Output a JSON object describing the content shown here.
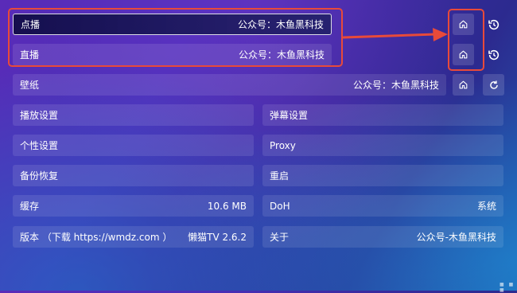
{
  "rows": {
    "dianbo": {
      "label": "点播",
      "value": "公众号：木鱼黑科技"
    },
    "zhibo": {
      "label": "直播",
      "value": "公众号：木鱼黑科技"
    },
    "bizhi": {
      "label": "壁纸",
      "value": "公众号：木鱼黑科技"
    }
  },
  "settings": {
    "play": {
      "label": "播放设置"
    },
    "danmu": {
      "label": "弹幕设置"
    },
    "personal": {
      "label": "个性设置"
    },
    "proxy": {
      "label": "Proxy"
    },
    "backup": {
      "label": "备份恢复"
    },
    "restart": {
      "label": "重启"
    },
    "cache": {
      "label": "缓存",
      "value": "10.6 MB"
    },
    "doh": {
      "label": "DoH",
      "value": "系统"
    },
    "version": {
      "label": "版本 （下载 https://wmdz.com ）",
      "value": "懒猫TV 2.6.2"
    },
    "about": {
      "label": "关于",
      "value": "公众号-木鱼黑科技"
    }
  },
  "icons": {
    "home": "home-icon",
    "history": "history-icon",
    "refresh": "refresh-icon"
  },
  "annotation_color": "#e84a3a"
}
